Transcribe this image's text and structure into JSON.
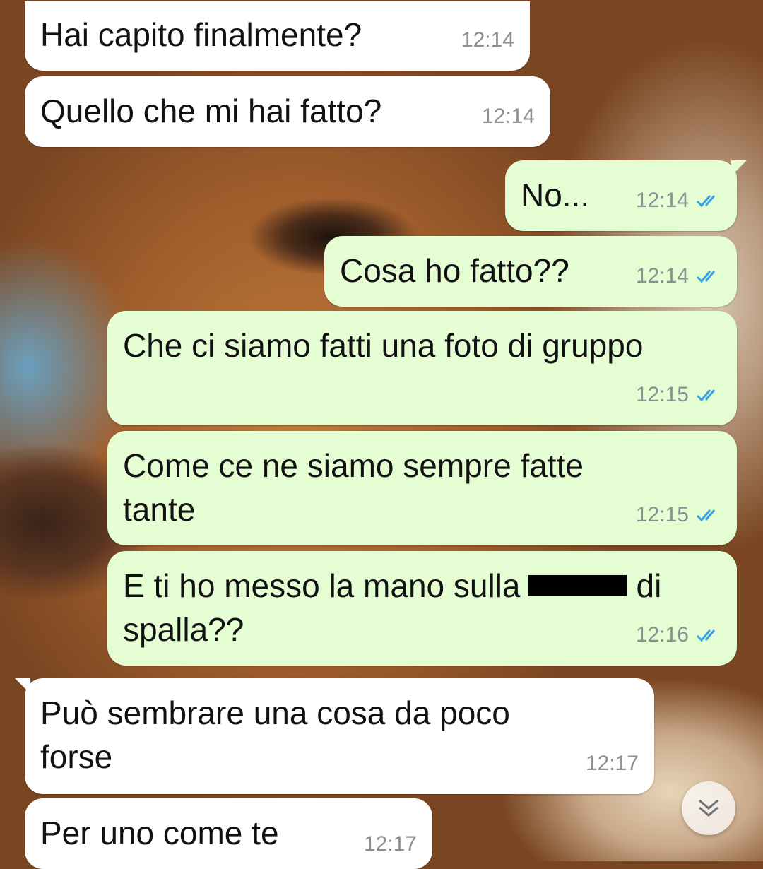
{
  "messages": [
    {
      "dir": "in",
      "text": "Hai capito finalmente?",
      "time": "12:14"
    },
    {
      "dir": "in",
      "text": "Quello che mi hai fatto?",
      "time": "12:14"
    },
    {
      "dir": "out",
      "text": "No...",
      "time": "12:14",
      "status": "read"
    },
    {
      "dir": "out",
      "text": "Cosa ho fatto??",
      "time": "12:14",
      "status": "read"
    },
    {
      "dir": "out",
      "text": "Che ci siamo fatti una foto di gruppo",
      "time": "12:15",
      "status": "read"
    },
    {
      "dir": "out",
      "text": "Come ce ne siamo sempre fatte\ntante",
      "time": "12:15",
      "status": "read"
    },
    {
      "dir": "out",
      "text_before": "E ti ho messo la mano sulla",
      "text_after": "di\nspalla??",
      "redacted": true,
      "time": "12:16",
      "status": "read"
    },
    {
      "dir": "in",
      "text": "Può sembrare una cosa da poco\nforse",
      "time": "12:17"
    },
    {
      "dir": "in",
      "text": "Per uno come te",
      "time": "12:17"
    }
  ],
  "scroll_button": {
    "icon": "double-chevron-down-icon"
  },
  "colors": {
    "incoming_bubble": "#ffffff",
    "outgoing_bubble": "#e5fdd3",
    "read_ticks": "#3aa0e6",
    "timestamp": "#8a8f93"
  }
}
